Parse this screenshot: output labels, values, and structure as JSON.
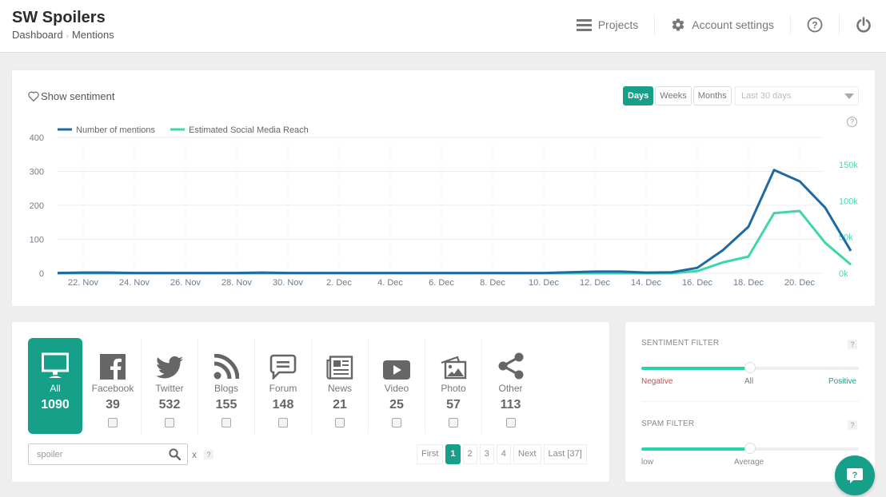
{
  "header": {
    "title": "SW Spoilers",
    "breadcrumb": [
      "Dashboard",
      "Mentions"
    ],
    "nav": {
      "projects": "Projects",
      "account_settings": "Account settings"
    }
  },
  "chart_panel": {
    "show_sentiment": "Show sentiment",
    "periods": [
      "Days",
      "Weeks",
      "Months"
    ],
    "active_period": "Days",
    "range_placeholder": "Last 30 days",
    "help": "?"
  },
  "chart_data": {
    "type": "line",
    "title": "",
    "legend_position": "top-left",
    "series": [
      {
        "name": "Number of mentions",
        "color": "#1f6aa0",
        "axis": "left",
        "values": [
          1,
          2,
          2,
          1,
          1,
          1,
          1,
          1,
          2,
          1,
          1,
          1,
          1,
          1,
          1,
          1,
          1,
          1,
          1,
          1,
          3,
          5,
          5,
          2,
          3,
          16,
          68,
          137,
          304,
          271,
          193,
          66
        ]
      },
      {
        "name": "Estimated Social Media Reach",
        "color": "#3dd6ad",
        "axis": "right",
        "values": [
          0,
          0,
          0,
          0,
          0,
          0,
          0,
          0,
          0,
          0,
          0,
          0,
          0,
          0,
          0,
          0,
          0,
          0,
          0,
          0,
          0,
          0,
          0,
          0,
          0,
          3000,
          15000,
          23000,
          83000,
          86000,
          42000,
          12000
        ]
      }
    ],
    "x_start_day": "21 Nov",
    "x_tick_labels": [
      "22. Nov",
      "24. Nov",
      "26. Nov",
      "28. Nov",
      "30. Nov",
      "2. Dec",
      "4. Dec",
      "6. Dec",
      "8. Dec",
      "10. Dec",
      "12. Dec",
      "14. Dec",
      "16. Dec",
      "18. Dec",
      "20. Dec"
    ],
    "y_left": {
      "ticks": [
        "0",
        "100",
        "200",
        "300",
        "400"
      ],
      "range": [
        0,
        400
      ]
    },
    "y_right": {
      "ticks": [
        "0k",
        "50k",
        "100k",
        "150k"
      ],
      "range": [
        0,
        187500
      ]
    },
    "grid": true
  },
  "sources": [
    {
      "id": "all",
      "label": "All",
      "count": "1090",
      "icon": "monitor-icon",
      "active": true
    },
    {
      "id": "facebook",
      "label": "Facebook",
      "count": "39",
      "icon": "facebook-icon"
    },
    {
      "id": "twitter",
      "label": "Twitter",
      "count": "532",
      "icon": "twitter-icon"
    },
    {
      "id": "blogs",
      "label": "Blogs",
      "count": "155",
      "icon": "rss-icon"
    },
    {
      "id": "forum",
      "label": "Forum",
      "count": "148",
      "icon": "forum-icon"
    },
    {
      "id": "news",
      "label": "News",
      "count": "21",
      "icon": "newspaper-icon"
    },
    {
      "id": "video",
      "label": "Video",
      "count": "25",
      "icon": "video-icon"
    },
    {
      "id": "photo",
      "label": "Photo",
      "count": "57",
      "icon": "photo-icon"
    },
    {
      "id": "other",
      "label": "Other",
      "count": "113",
      "icon": "share-icon"
    }
  ],
  "search": {
    "value": "spoiler",
    "clear": "x",
    "help": "?"
  },
  "pagination": {
    "first": "First",
    "pages": [
      "1",
      "2",
      "3",
      "4"
    ],
    "current": "1",
    "next": "Next",
    "last": "Last [37]"
  },
  "filters": {
    "sentiment": {
      "title": "SENTIMENT FILTER",
      "help": "?",
      "value": 0.5,
      "labels": {
        "left": "Negative",
        "middle": "All",
        "right": "Positive"
      },
      "colors": {
        "negative": "#c0504d",
        "positive": "#16a08a"
      }
    },
    "spam": {
      "title": "SPAM FILTER",
      "help": "?",
      "value": 0.5,
      "labels": {
        "left": "low",
        "middle": "Average"
      }
    }
  },
  "colors": {
    "accent": "#16a08a",
    "slider": "#2bd3a9"
  },
  "chat": {
    "label": "?"
  }
}
